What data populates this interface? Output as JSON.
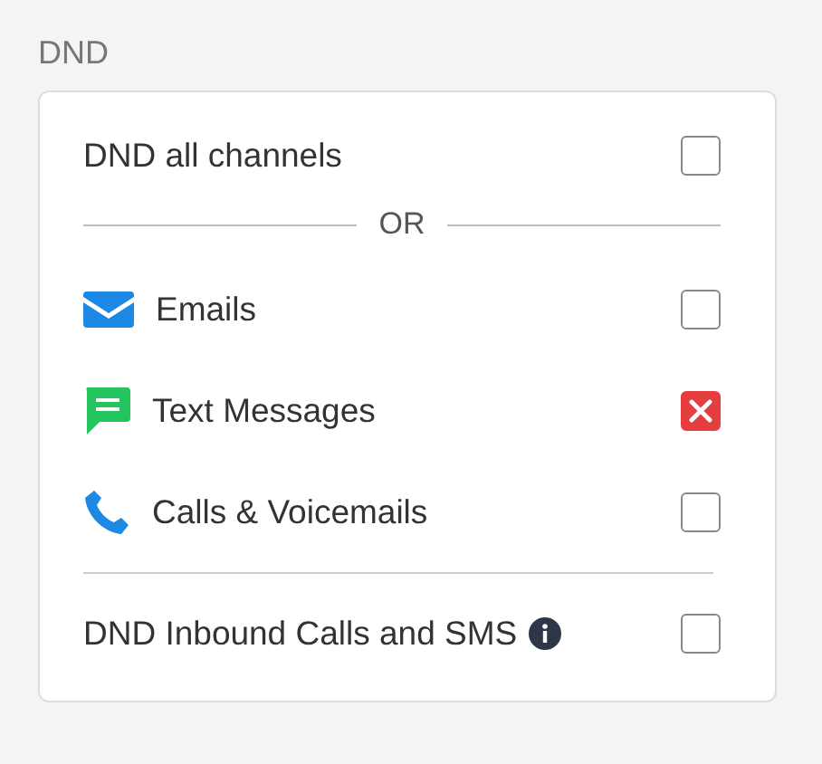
{
  "section_title": "DND",
  "all_channels": {
    "label": "DND all channels",
    "checked": false
  },
  "separator": "OR",
  "channels": [
    {
      "kind": "email",
      "label": "Emails",
      "checked": false
    },
    {
      "kind": "sms",
      "label": "Text Messages",
      "checked": true
    },
    {
      "kind": "call",
      "label": "Calls & Voicemails",
      "checked": false
    }
  ],
  "inbound": {
    "label": "DND Inbound Calls and SMS",
    "checked": false
  }
}
